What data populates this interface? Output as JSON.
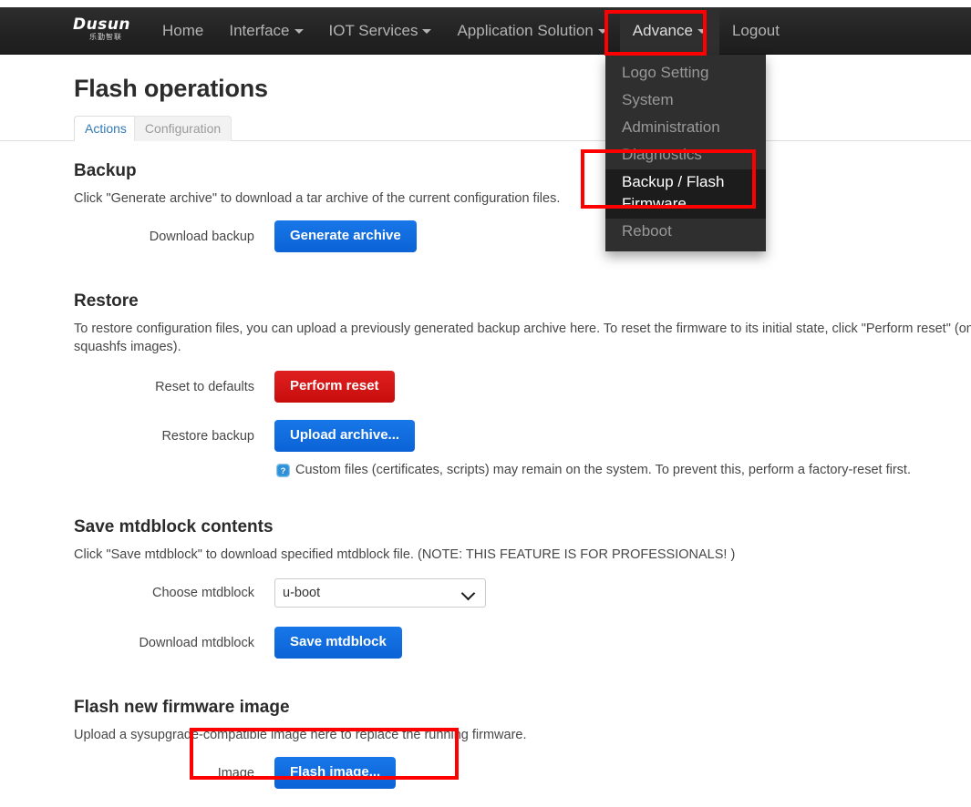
{
  "navbar": {
    "brand": {
      "name": "Dusun",
      "sub": "乐勤智联"
    },
    "items": [
      {
        "label": "Home",
        "caret": false
      },
      {
        "label": "Interface",
        "caret": true
      },
      {
        "label": "IOT Services",
        "caret": true
      },
      {
        "label": "Application Solution",
        "caret": true
      },
      {
        "label": "Advance",
        "caret": true
      },
      {
        "label": "Logout",
        "caret": false
      }
    ]
  },
  "dropdown": {
    "items": [
      {
        "label": "Logo Setting",
        "active": false
      },
      {
        "label": "System",
        "active": false
      },
      {
        "label": "Administration",
        "active": false
      },
      {
        "label": "Diagnostics",
        "active": false
      },
      {
        "label": "Backup / Flash Firmware",
        "active": true
      },
      {
        "label": "Reboot",
        "active": false
      }
    ]
  },
  "page": {
    "title": "Flash operations",
    "tabs": [
      {
        "label": "Actions",
        "active": true
      },
      {
        "label": "Configuration",
        "active": false
      }
    ]
  },
  "backup": {
    "heading": "Backup",
    "description": "Click \"Generate archive\" to download a tar archive of the current configuration files.",
    "row_label": "Download backup",
    "button_label": "Generate archive"
  },
  "restore": {
    "heading": "Restore",
    "description": "To restore configuration files, you can upload a previously generated backup archive here. To reset the firmware to its initial state, click \"Perform reset\" (only possible with squashfs images).",
    "reset_label": "Reset to defaults",
    "reset_button": "Perform reset",
    "upload_label": "Restore backup",
    "upload_button": "Upload archive...",
    "help_icon": "help-question-icon",
    "help_text": "Custom files (certificates, scripts) may remain on the system. To prevent this, perform a factory-reset first."
  },
  "mtdblock": {
    "heading": "Save mtdblock contents",
    "description": "Click \"Save mtdblock\" to download specified mtdblock file. (NOTE: THIS FEATURE IS FOR PROFESSIONALS! )",
    "choose_label": "Choose mtdblock",
    "selected_value": "u-boot",
    "options": [
      "u-boot"
    ],
    "download_label": "Download mtdblock",
    "save_button": "Save mtdblock"
  },
  "firmware": {
    "heading": "Flash new firmware image",
    "description": "Upload a sysupgrade-compatible image here to replace the running firmware.",
    "image_label": "Image",
    "flash_button": "Flash image..."
  },
  "colors": {
    "accent_blue": "#0b63d6",
    "danger_red": "#c70c0c",
    "navbar_dark": "#222222",
    "annotation_red": "#ff0000",
    "tab_link": "#337ab7"
  }
}
